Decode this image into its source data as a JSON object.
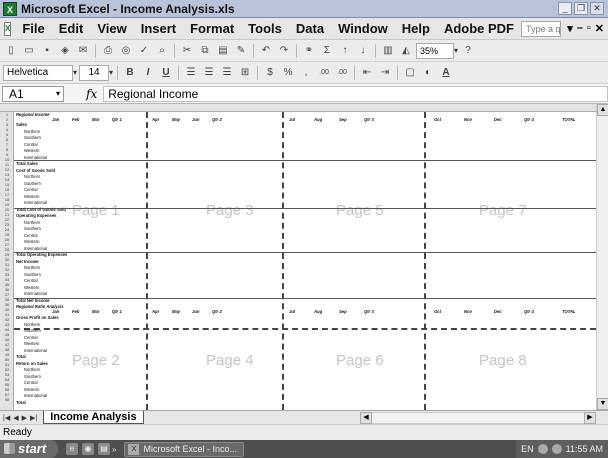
{
  "window": {
    "title": "Microsoft Excel - Income Analysis.xls",
    "app_icon": "excel-icon"
  },
  "menubar": {
    "items": [
      {
        "label": "File"
      },
      {
        "label": "Edit"
      },
      {
        "label": "View"
      },
      {
        "label": "Insert"
      },
      {
        "label": "Format"
      },
      {
        "label": "Tools"
      },
      {
        "label": "Data"
      },
      {
        "label": "Window"
      },
      {
        "label": "Help"
      },
      {
        "label": "Adobe PDF"
      }
    ],
    "help_placeholder": "Type a question for help"
  },
  "toolbar": {
    "zoom": "35%",
    "font": "Helvetica",
    "font_size": "14",
    "bold": "B",
    "italic": "I",
    "underline": "U",
    "currency": "$",
    "percent": "%",
    "comma": ",",
    "inc_decimal": ".00",
    "dec_decimal": ".00"
  },
  "formula_bar": {
    "name_box": "A1",
    "fx": "fx",
    "value": "Regional Income"
  },
  "spreadsheet": {
    "month_headers": [
      "Jan",
      "Feb",
      "Mar",
      "Qtr 1",
      "Apr",
      "May",
      "Jun",
      "Qtr 2",
      "Jul",
      "Aug",
      "Sep",
      "Qtr 3",
      "Oct",
      "Nov",
      "Dec",
      "Qtr 4",
      "TOTAL"
    ],
    "section_titles": [
      "Regional Income",
      "Regional Ratio Analysis"
    ],
    "row_labels": [
      "Sales",
      "Northern",
      "Southern",
      "Central",
      "Western",
      "International",
      "Total Sales",
      "Cost of Goods Sold",
      "Northern",
      "Southern",
      "Central",
      "Western",
      "International",
      "Total Cost of Goods Sold",
      "Operating Expenses",
      "Northern",
      "Southern",
      "Central",
      "Western",
      "International",
      "Total Operating Expenses",
      "Net Income",
      "Northern",
      "Southern",
      "Central",
      "Western",
      "International",
      "Total Net Income"
    ],
    "ratio_labels": [
      "Gross Profit on Sales",
      "Northern",
      "Southern",
      "Central",
      "Western",
      "International",
      "Total",
      "Return on Sales",
      "Northern",
      "Southern",
      "Central",
      "Western",
      "International",
      "Total"
    ],
    "page_labels": [
      "Page 1",
      "Page 3",
      "Page 5",
      "Page 7",
      "Page 2",
      "Page 4",
      "Page 6",
      "Page 8"
    ]
  },
  "sheet_tabs": [
    {
      "label": "Income Analysis"
    }
  ],
  "status": {
    "text": "Ready"
  },
  "taskbar": {
    "start_label": "start",
    "task_label": "Microsoft Excel - Inco...",
    "tray_lang": "EN",
    "clock": "11:55 AM"
  }
}
